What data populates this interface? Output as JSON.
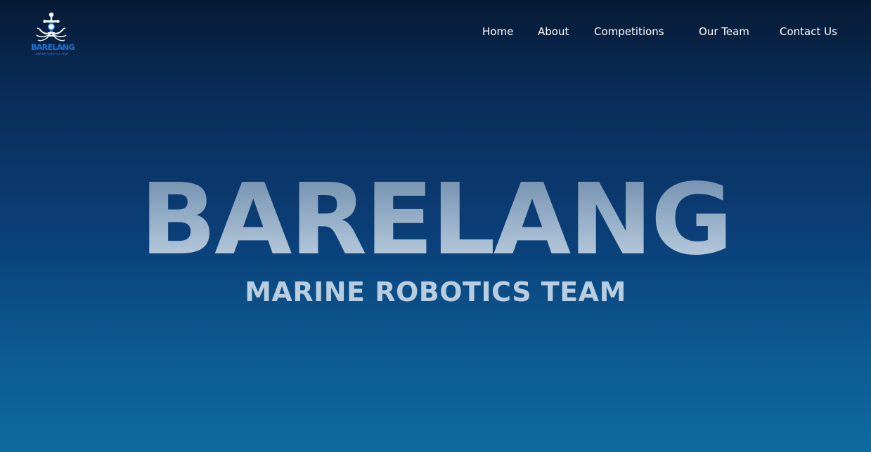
{
  "logo": {
    "title": "BARELANG",
    "subtitle": "MARINE ROBOTICS TEAM",
    "icon": "anchor-robot-logo"
  },
  "nav": {
    "items": [
      {
        "label": "Home"
      },
      {
        "label": "About"
      },
      {
        "label": "Competitions"
      },
      {
        "label": "Our Team"
      },
      {
        "label": "Contact Us"
      }
    ]
  },
  "hero": {
    "title": "BARELANG",
    "subtitle": "MARINE ROBOTICS TEAM"
  },
  "colors": {
    "background_top": "#061a33",
    "background_bottom": "#0f6aa0",
    "nav_text": "#ffffff",
    "hero_text": "#b9cde0",
    "logo_blue": "#1f74d6"
  }
}
